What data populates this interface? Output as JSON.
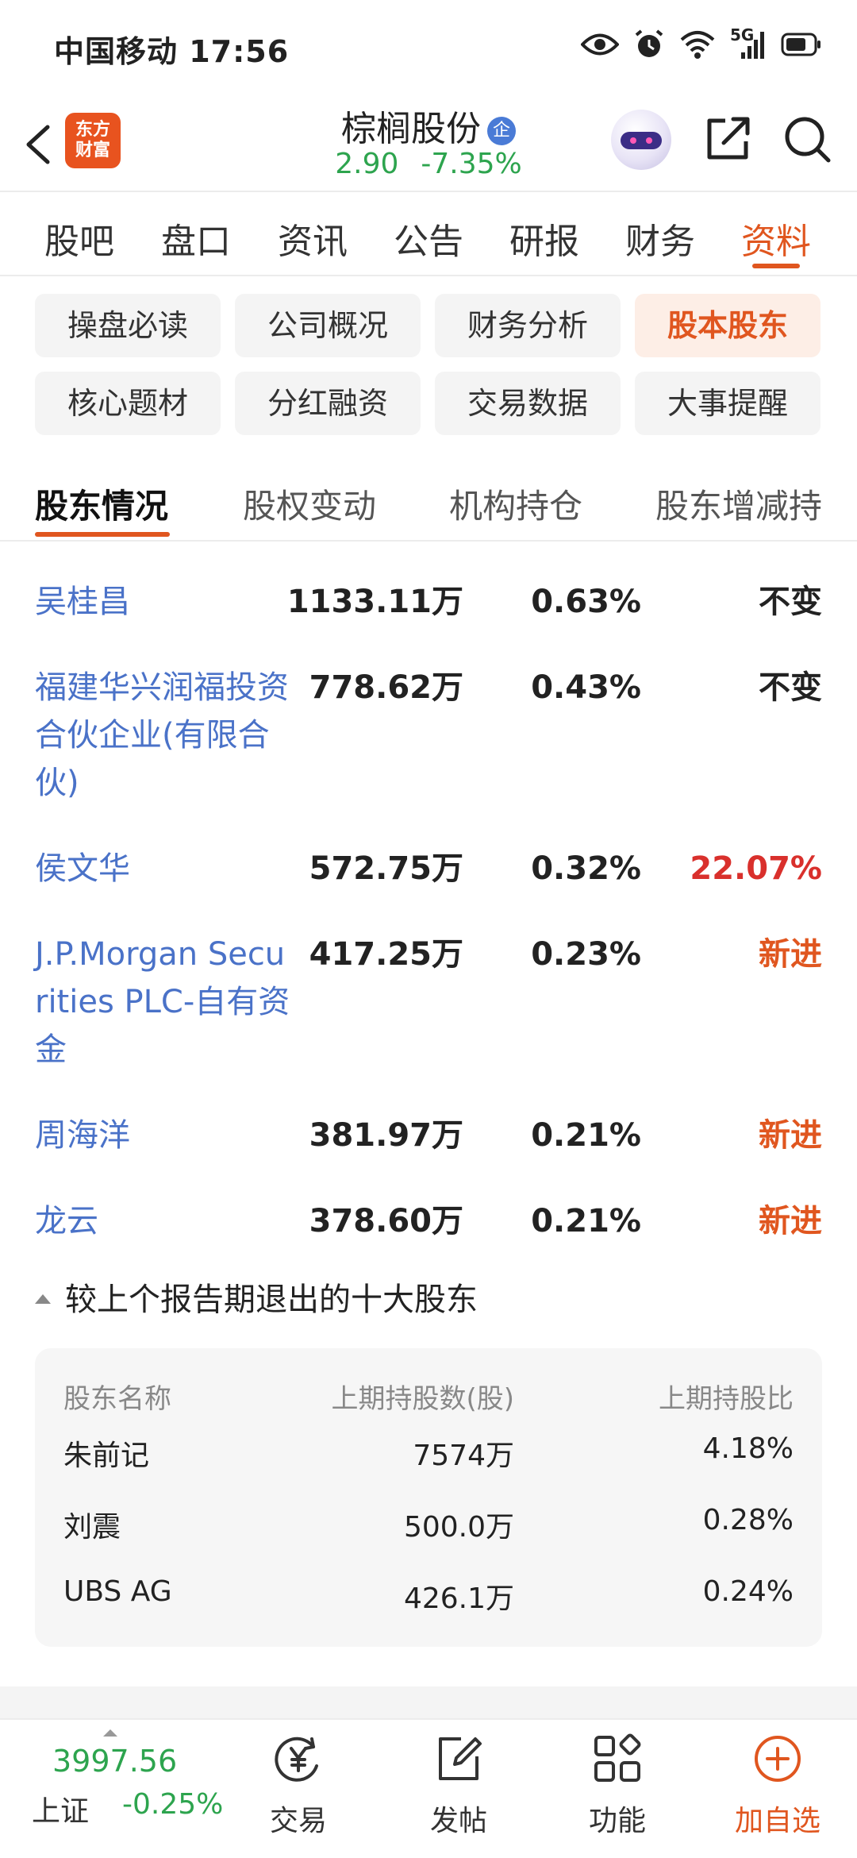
{
  "status_bar": {
    "carrier_time": "中国移动 17:56",
    "network": "5G"
  },
  "header": {
    "brand_logo_text": "东方财富",
    "stock_name": "棕榈股份",
    "stock_tag": "企",
    "price": "2.90",
    "change_pct": "-7.35%"
  },
  "main_tabs": [
    "股吧",
    "盘口",
    "资讯",
    "公告",
    "研报",
    "财务",
    "资料"
  ],
  "main_tabs_active": "资料",
  "sub_nav": [
    "操盘必读",
    "公司概况",
    "财务分析",
    "股本股东",
    "核心题材",
    "分红融资",
    "交易数据",
    "大事提醒"
  ],
  "sub_nav_active": "股本股东",
  "section_tabs": [
    "股东情况",
    "股权变动",
    "机构持仓",
    "股东增减持"
  ],
  "section_tabs_active": "股东情况",
  "holders": [
    {
      "name": "吴桂昌",
      "shares": "1133.11万",
      "ratio": "0.63%",
      "change": "不变"
    },
    {
      "name": "福建华兴润福投资合伙企业(有限合伙)",
      "shares": "778.62万",
      "ratio": "0.43%",
      "change": "不变"
    },
    {
      "name": "侯文华",
      "shares": "572.75万",
      "ratio": "0.32%",
      "change": "22.07%"
    },
    {
      "name": "J.P.Morgan Securities PLC-自有资金",
      "shares": "417.25万",
      "ratio": "0.23%",
      "change": "新进"
    },
    {
      "name": "周海洋",
      "shares": "381.97万",
      "ratio": "0.21%",
      "change": "新进"
    },
    {
      "name": "龙云",
      "shares": "378.60万",
      "ratio": "0.21%",
      "change": "新进"
    }
  ],
  "exited": {
    "title": "较上个报告期退出的十大股东",
    "headers": [
      "股东名称",
      "上期持股数(股)",
      "上期持股比"
    ],
    "rows": [
      {
        "name": "朱前记",
        "shares": "7574万",
        "ratio": "4.18%"
      },
      {
        "name": "刘震",
        "shares": "500.0万",
        "ratio": "0.28%"
      },
      {
        "name": "UBS AG",
        "shares": "426.1万",
        "ratio": "0.24%"
      }
    ]
  },
  "bottom_bar": {
    "index_value": "3997.56",
    "index_name": "上证",
    "index_change": "-0.25%",
    "nav": [
      "交易",
      "发帖",
      "功能",
      "加自选"
    ]
  },
  "colors": {
    "accent": "#e0561f",
    "link_blue": "#4a72c8",
    "down_green": "#2da44e",
    "up_red": "#d9302c"
  }
}
